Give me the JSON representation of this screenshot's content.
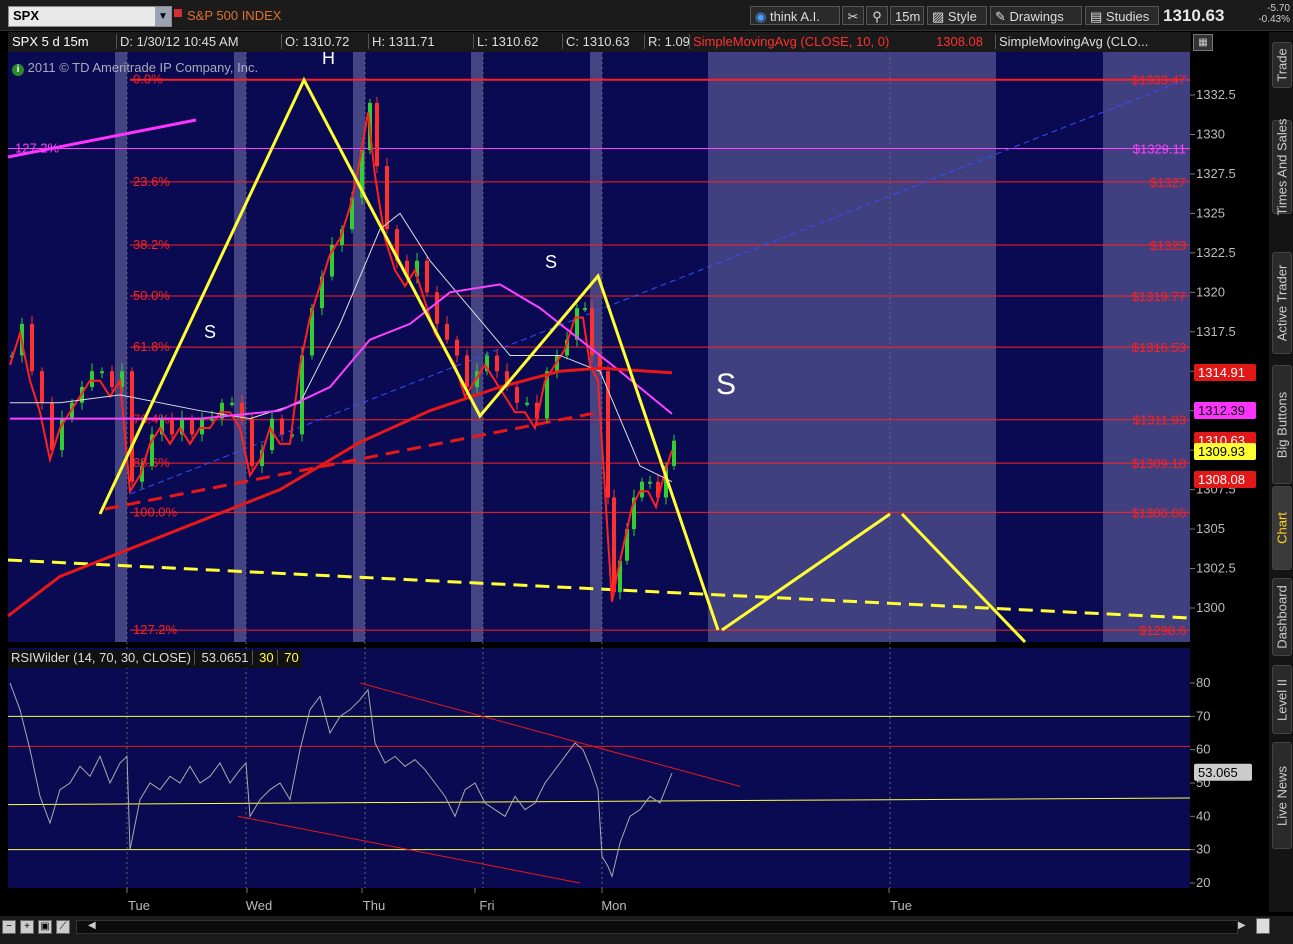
{
  "toolbar": {
    "symbol": "SPX",
    "index_name": "S&P 500 INDEX",
    "think_ai": "think A.I.",
    "interval": "15m",
    "style": "Style",
    "drawings": "Drawings",
    "studies": "Studies",
    "last_price": "1310.63",
    "net_change": "-5.70",
    "net_change_pct": "-0.43%"
  },
  "infobar": {
    "symbol_period": "SPX 5 d 15m",
    "date": "D: 1/30/12 10:45 AM",
    "open": "O: 1310.72",
    "high": "H: 1311.71",
    "low": "L: 1310.62",
    "close": "C: 1310.63",
    "range": "R: 1.09",
    "sma1": "SimpleMovingAvg (CLOSE, 10, 0)",
    "sma1_val": "1308.08",
    "sma2": "SimpleMovingAvg (CLO..."
  },
  "copyright": "2011 © TD Ameritrade IP Company, Inc.",
  "side_tabs": [
    "Trade",
    "Times And Sales",
    "Active Trader",
    "Big Buttons",
    "Chart",
    "Dashboard",
    "Level II",
    "Live News"
  ],
  "colors": {
    "background": "#0a0a52",
    "fib": "#ff2020",
    "pattern": "#ffff33",
    "sma_fast": "#ff2020",
    "sma_mid": "#ff40ff",
    "sma_slow": "#e81818",
    "price_up": "#33cc33",
    "price_down": "#ff3030",
    "rsi": "#aaaaaa"
  },
  "chart_data": [
    {
      "type": "candlestick",
      "title": "SPX 5 d 15m",
      "ylim": [
        1298,
        1335
      ],
      "yticks": [
        "1300",
        "1302.5",
        "1305",
        "1307.5",
        "1310",
        "1312.5",
        "1315",
        "1317.5",
        "1320",
        "1322.5",
        "1325",
        "1327.5",
        "1330",
        "1332.5"
      ],
      "x_labels": [
        "Tue",
        "Wed",
        "Thu",
        "Fri",
        "Mon",
        "Tue"
      ],
      "fib_levels": [
        {
          "label": "0.0%",
          "price_label": "$1333.47",
          "value": 1333.47
        },
        {
          "label": "127.2%",
          "price_label": "$1329.11",
          "value": 1329.11
        },
        {
          "label": "23.6%",
          "price_label": "$1327",
          "value": 1327.0
        },
        {
          "label": "38.2%",
          "price_label": "$1323",
          "value": 1323.0
        },
        {
          "label": "50.0%",
          "price_label": "$1319.77",
          "value": 1319.77
        },
        {
          "label": "61.8%",
          "price_label": "$1316.53",
          "value": 1316.53
        },
        {
          "label": "76.4%",
          "price_label": "$1311.93",
          "value": 1311.93
        },
        {
          "label": "88.6%",
          "price_label": "$1309.18",
          "value": 1309.18
        },
        {
          "label": "100.0%",
          "price_label": "$1306.06",
          "value": 1306.06
        },
        {
          "label": "127.2%",
          "price_label": "$1298.6",
          "value": 1298.6
        }
      ],
      "price_markers": [
        {
          "label": "1314.91",
          "bg": "#e01818",
          "fg": "#ffffff"
        },
        {
          "label": "1312.39",
          "bg": "#ff33ff",
          "fg": "#000000"
        },
        {
          "label": "1310.63",
          "bg": "#e01818",
          "fg": "#ffffff"
        },
        {
          "label": "1309.93",
          "bg": "#ffff33",
          "fg": "#000000"
        },
        {
          "label": "1308.08",
          "bg": "#e01818",
          "fg": "#ffffff"
        }
      ],
      "pattern_labels": [
        "S",
        "H",
        "S",
        "S"
      ]
    },
    {
      "type": "line",
      "title": "RSIWilder (14, 70, 30, CLOSE)",
      "value": "53.0651",
      "levels": [
        "30",
        "70"
      ],
      "current_marker": "53.065",
      "ylim": [
        20,
        85
      ],
      "yticks": [
        "20",
        "30",
        "40",
        "50",
        "60",
        "70",
        "80"
      ]
    }
  ]
}
